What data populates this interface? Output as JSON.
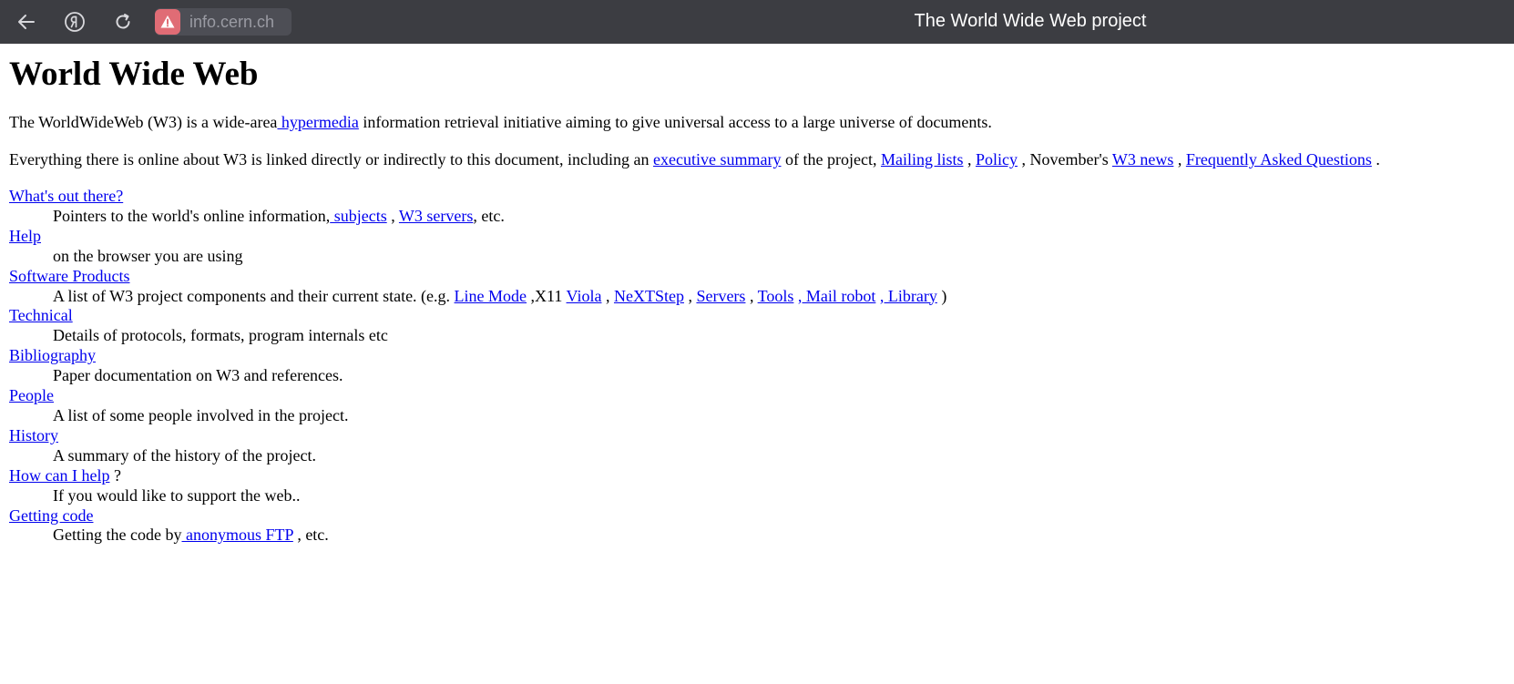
{
  "browser": {
    "url": "info.cern.ch",
    "window_title": "The World Wide Web project"
  },
  "page": {
    "heading": "World Wide Web",
    "intro1": {
      "t1": "The WorldWideWeb (W3) is a wide-area",
      "link_hypermedia": " hypermedia",
      "t2": " information retrieval initiative aiming to give universal access to a large universe of documents."
    },
    "intro2": {
      "t1": "Everything there is online about W3 is linked directly or indirectly to this document, including an ",
      "link_summary": "executive summary",
      "t2": " of the project, ",
      "link_mailing": "Mailing lists",
      "t3": " , ",
      "link_policy": "Policy",
      "t4": " , November's ",
      "link_news": "W3 news",
      "t5": " , ",
      "link_faq": "Frequently Asked Questions",
      "t6": " ."
    },
    "items": [
      {
        "link": "What's out there?",
        "desc": {
          "t1": "Pointers to the world's online information,",
          "link_subjects": " subjects",
          "t2": " , ",
          "link_servers": "W3 servers",
          "t3": ", etc."
        }
      },
      {
        "link": "Help",
        "desc": "on the browser you are using"
      },
      {
        "link": "Software Products",
        "desc": {
          "t1": "A list of W3 project components and their current state. (e.g. ",
          "link_linemode": "Line Mode",
          "t2": " ,X11 ",
          "link_viola": "Viola",
          "t3": " , ",
          "link_next": "NeXTStep",
          "t4": " , ",
          "link_servers": "Servers",
          "t5": " , ",
          "link_tools": "Tools",
          "t6": " ",
          "link_mailrobot": ", Mail robot",
          "t7": " ",
          "link_library": ", Library",
          "t8": " )"
        }
      },
      {
        "link": "Technical",
        "desc": "Details of protocols, formats, program internals etc"
      },
      {
        "link": "Bibliography",
        "desc": "Paper documentation on W3 and references."
      },
      {
        "link": "People",
        "desc": "A list of some people involved in the project."
      },
      {
        "link": "History",
        "desc": "A summary of the history of the project."
      },
      {
        "link": "How can I help",
        "after": " ?",
        "desc": "If you would like to support the web.."
      },
      {
        "link": "Getting code",
        "desc": {
          "t1": "Getting the code by",
          "link_ftp": " anonymous FTP",
          "t2": " , etc."
        }
      }
    ]
  },
  "icons": {
    "back": "arrow-left-icon",
    "yandex": "yandex-icon",
    "reload": "reload-icon",
    "warning": "warning-icon"
  },
  "colors": {
    "toolbar": "#3c3d42",
    "link": "#0000ee",
    "warning": "#e06c75"
  }
}
